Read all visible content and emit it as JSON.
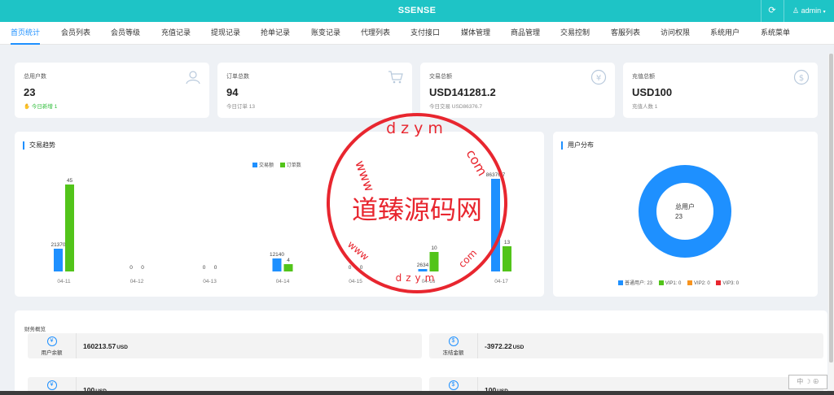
{
  "app": {
    "title": "SSENSE",
    "user": "admin"
  },
  "nav": [
    "首页统计",
    "会员列表",
    "会员等级",
    "充值记录",
    "提现记录",
    "抢单记录",
    "账变记录",
    "代理列表",
    "支付接口",
    "媒体管理",
    "商品管理",
    "交易控制",
    "客服列表",
    "访问权限",
    "系统用户",
    "系统菜单"
  ],
  "stats": [
    {
      "label": "总用户数",
      "value": "23",
      "sub": "今日新增 1",
      "icon": "users-icon"
    },
    {
      "label": "订单总数",
      "value": "94",
      "sub": "今日订单 13",
      "icon": "cart-icon"
    },
    {
      "label": "交易总额",
      "value": "USD141281.2",
      "sub": "今日交易 USD86376.7",
      "icon": "yen-icon"
    },
    {
      "label": "充值总额",
      "value": "USD100",
      "sub": "充值人数 1",
      "icon": "dollar-icon"
    }
  ],
  "trend": {
    "title": "交易趋势",
    "legend": [
      "交易额",
      "订单数"
    ]
  },
  "chart_data": [
    {
      "type": "bar",
      "categories": [
        "04-11",
        "04-12",
        "04-13",
        "04-14",
        "04-15",
        "04-16",
        "04-17"
      ],
      "series": [
        {
          "name": "交易额",
          "values": [
            21370,
            0,
            0,
            12140,
            0,
            2634,
            86376.7
          ],
          "color": "#1e90ff"
        },
        {
          "name": "订单数",
          "values": [
            45,
            0,
            0,
            4,
            0,
            10,
            13
          ],
          "color": "#52c41a"
        }
      ],
      "labels": [
        [
          "21370",
          "0",
          "0",
          "12140",
          "0",
          "2634",
          "86376.7"
        ],
        [
          "45",
          "0",
          "0",
          "4",
          "0",
          "10",
          "13"
        ]
      ]
    },
    {
      "type": "pie",
      "title": "用户分布",
      "center_label": "总用户",
      "center_value": "23",
      "slices": [
        {
          "name": "普通用户",
          "value": 23,
          "color": "#1e90ff"
        },
        {
          "name": "VIP1",
          "value": 0,
          "color": "#52c41a"
        },
        {
          "name": "VIP2",
          "value": 0,
          "color": "#f7931e"
        },
        {
          "name": "VIP3",
          "value": 0,
          "color": "#e8262f"
        }
      ],
      "legend": [
        "普通用户: 23",
        "VIP1: 0",
        "VIP2: 0",
        "VIP3: 0"
      ]
    }
  ],
  "finance": {
    "title": "财务概览",
    "items": [
      {
        "label": "用户余额",
        "value": "160213.57",
        "unit": "USD",
        "icon": "yen-icon"
      },
      {
        "label": "冻结金额",
        "value": "-3972.22",
        "unit": "USD",
        "icon": "dollar-icon"
      },
      {
        "label": "",
        "value": "100",
        "unit": "USD",
        "icon": "yen-icon"
      },
      {
        "label": "",
        "value": "100",
        "unit": "USD",
        "icon": "dollar-icon"
      }
    ]
  },
  "watermark": {
    "text": "道臻源码网",
    "ring_top": "dzym",
    "ring_left": "www",
    "ring_right": "com",
    "ring_bottom_left": "www",
    "ring_bottom": "dzym",
    "ring_bottom_right": "com",
    "color": "#e8262f"
  },
  "corner_glyphs": "中 ☽ ⊕"
}
